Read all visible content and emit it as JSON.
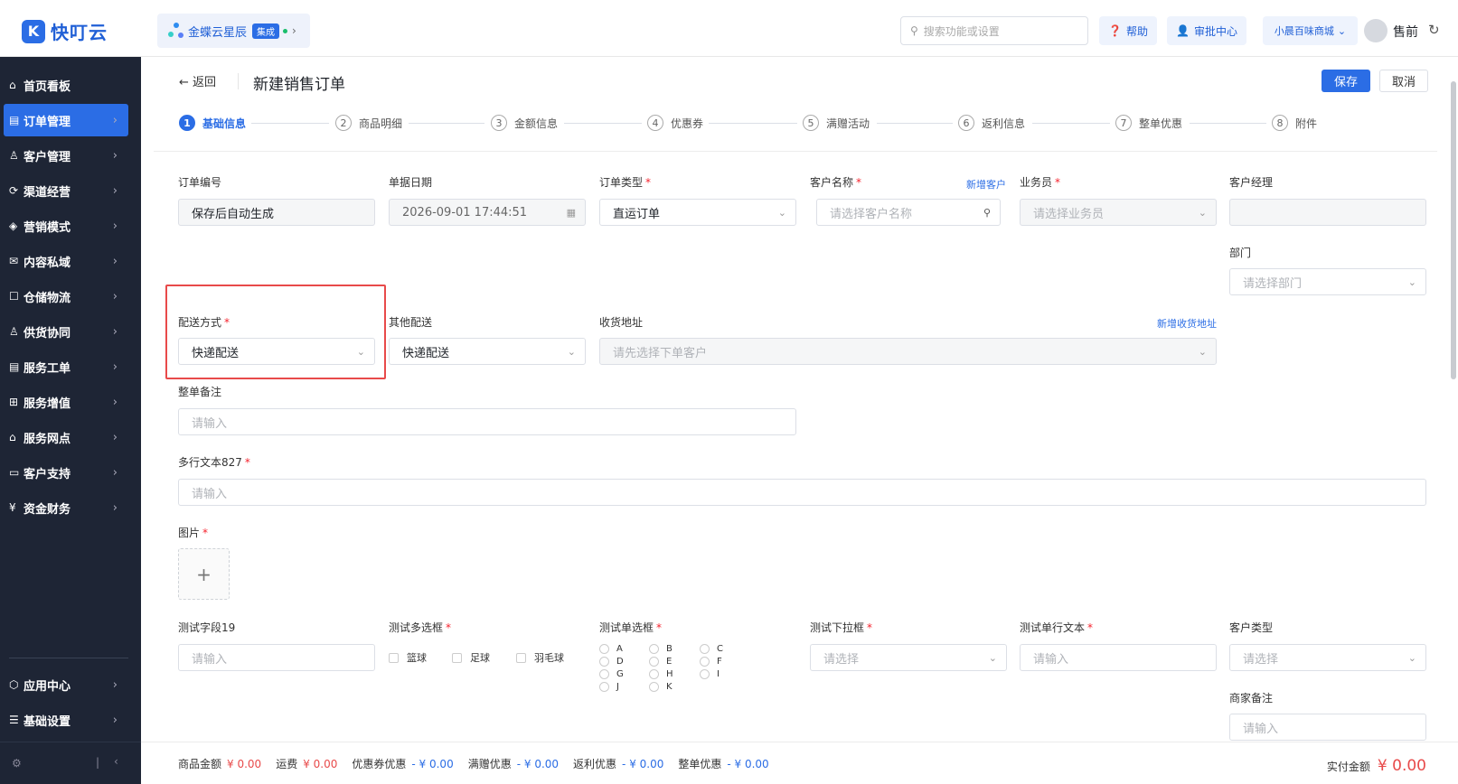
{
  "brand": {
    "name": "快叮云",
    "mark": "K"
  },
  "app_switch": {
    "name": "金蝶云星辰",
    "badge": "集成"
  },
  "header": {
    "search_placeholder": "搜索功能或设置",
    "help": "帮助",
    "approval": "审批中心",
    "store": "小晨百味商城",
    "user": "售前"
  },
  "sidebar": {
    "items": [
      {
        "label": "首页看板",
        "icon": "home-icon"
      },
      {
        "label": "订单管理",
        "icon": "order-icon",
        "active": true
      },
      {
        "label": "客户管理",
        "icon": "customer-icon"
      },
      {
        "label": "渠道经营",
        "icon": "channel-icon"
      },
      {
        "label": "营销模式",
        "icon": "marketing-icon"
      },
      {
        "label": "内容私域",
        "icon": "content-icon"
      },
      {
        "label": "仓储物流",
        "icon": "warehouse-icon"
      },
      {
        "label": "供货协同",
        "icon": "supply-icon"
      },
      {
        "label": "服务工单",
        "icon": "ticket-icon"
      },
      {
        "label": "服务增值",
        "icon": "value-icon"
      },
      {
        "label": "服务网点",
        "icon": "outlet-icon"
      },
      {
        "label": "客户支持",
        "icon": "support-icon"
      },
      {
        "label": "资金财务",
        "icon": "finance-icon"
      }
    ],
    "bottom_items": [
      {
        "label": "应用中心"
      },
      {
        "label": "基础设置"
      }
    ]
  },
  "page": {
    "back": "返回",
    "title": "新建销售订单",
    "save": "保存",
    "cancel": "取消"
  },
  "steps": [
    {
      "num": "1",
      "label": "基础信息"
    },
    {
      "num": "2",
      "label": "商品明细"
    },
    {
      "num": "3",
      "label": "金额信息"
    },
    {
      "num": "4",
      "label": "优惠券"
    },
    {
      "num": "5",
      "label": "满赠活动"
    },
    {
      "num": "6",
      "label": "返利信息"
    },
    {
      "num": "7",
      "label": "整单优惠"
    },
    {
      "num": "8",
      "label": "附件"
    }
  ],
  "form": {
    "order_no": {
      "label": "订单编号",
      "value": "保存后自动生成"
    },
    "doc_date": {
      "label": "单据日期",
      "value": "2026-09-01 17:44:51"
    },
    "order_type": {
      "label": "订单类型",
      "value": "直运订单"
    },
    "customer": {
      "label": "客户名称",
      "placeholder": "请选择客户名称",
      "link": "新增客户"
    },
    "salesman": {
      "label": "业务员",
      "placeholder": "请选择业务员"
    },
    "manager": {
      "label": "客户经理"
    },
    "dept": {
      "label": "部门",
      "placeholder": "请选择部门"
    },
    "delivery": {
      "label": "配送方式",
      "value": "快递配送"
    },
    "other_delivery": {
      "label": "其他配送",
      "value": "快递配送"
    },
    "address": {
      "label": "收货地址",
      "placeholder": "请先选择下单客户",
      "link": "新增收货地址"
    },
    "remark": {
      "label": "整单备注",
      "placeholder": "请输入"
    },
    "multiline": {
      "label": "多行文本827",
      "placeholder": "请输入"
    },
    "image": {
      "label": "图片",
      "plus": "+"
    },
    "test19": {
      "label": "测试字段19",
      "placeholder": "请输入"
    },
    "multi_select": {
      "label": "测试多选框",
      "options": [
        "篮球",
        "足球",
        "羽毛球"
      ]
    },
    "single_select": {
      "label": "测试单选框",
      "options": [
        "A",
        "B",
        "C",
        "D",
        "E",
        "F",
        "G",
        "H",
        "I",
        "J",
        "K"
      ]
    },
    "dropdown": {
      "label": "测试下拉框",
      "placeholder": "请选择"
    },
    "single_text": {
      "label": "测试单行文本",
      "placeholder": "请输入"
    },
    "customer_type": {
      "label": "客户类型",
      "placeholder": "请选择"
    },
    "merchant_remark": {
      "label": "商家备注",
      "placeholder": "请输入"
    }
  },
  "footer": {
    "goods_label": "商品金额",
    "goods": "¥ 0.00",
    "freight_label": "运费",
    "freight": "¥ 0.00",
    "coupon_label": "优惠券优惠",
    "coupon": "- ¥ 0.00",
    "gift_label": "满赠优惠",
    "gift": "- ¥ 0.00",
    "rebate_label": "返利优惠",
    "rebate": "- ¥ 0.00",
    "whole_label": "整单优惠",
    "whole": "- ¥ 0.00",
    "total_label": "实付金额",
    "total": "¥ 0.00"
  }
}
